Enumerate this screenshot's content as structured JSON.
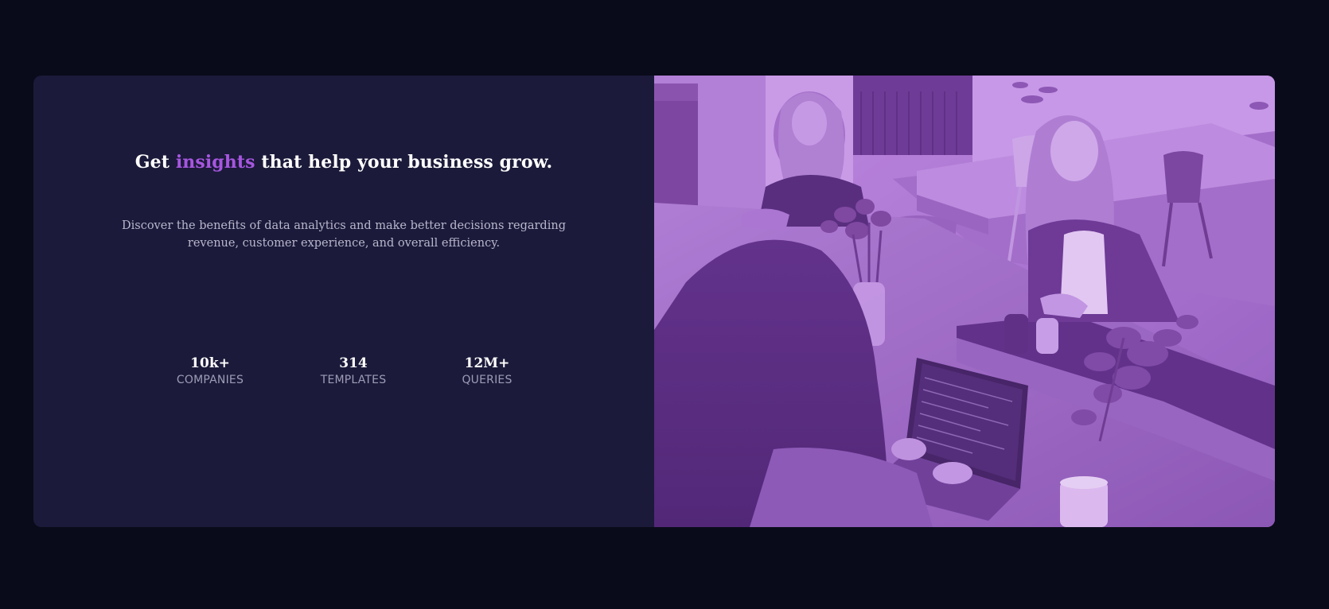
{
  "hero": {
    "title_before": "Get ",
    "title_highlight": "insights",
    "title_after": " that help your business grow.",
    "description": "Discover the benefits of data analytics and make better decisions regarding revenue, customer experience, and overall efficiency."
  },
  "stats": [
    {
      "value": "10k+",
      "label": "COMPANIES"
    },
    {
      "value": "314",
      "label": "TEMPLATES"
    },
    {
      "value": "12M+",
      "label": "QUERIES"
    }
  ],
  "colors": {
    "page_background": "#090b1a",
    "card_background": "#1b1a3a",
    "accent": "#a756e0",
    "photo_tint": "#8b4fb8"
  },
  "image": {
    "subject": "three women working at a shared desk with a laptop, purple tinted photo"
  }
}
